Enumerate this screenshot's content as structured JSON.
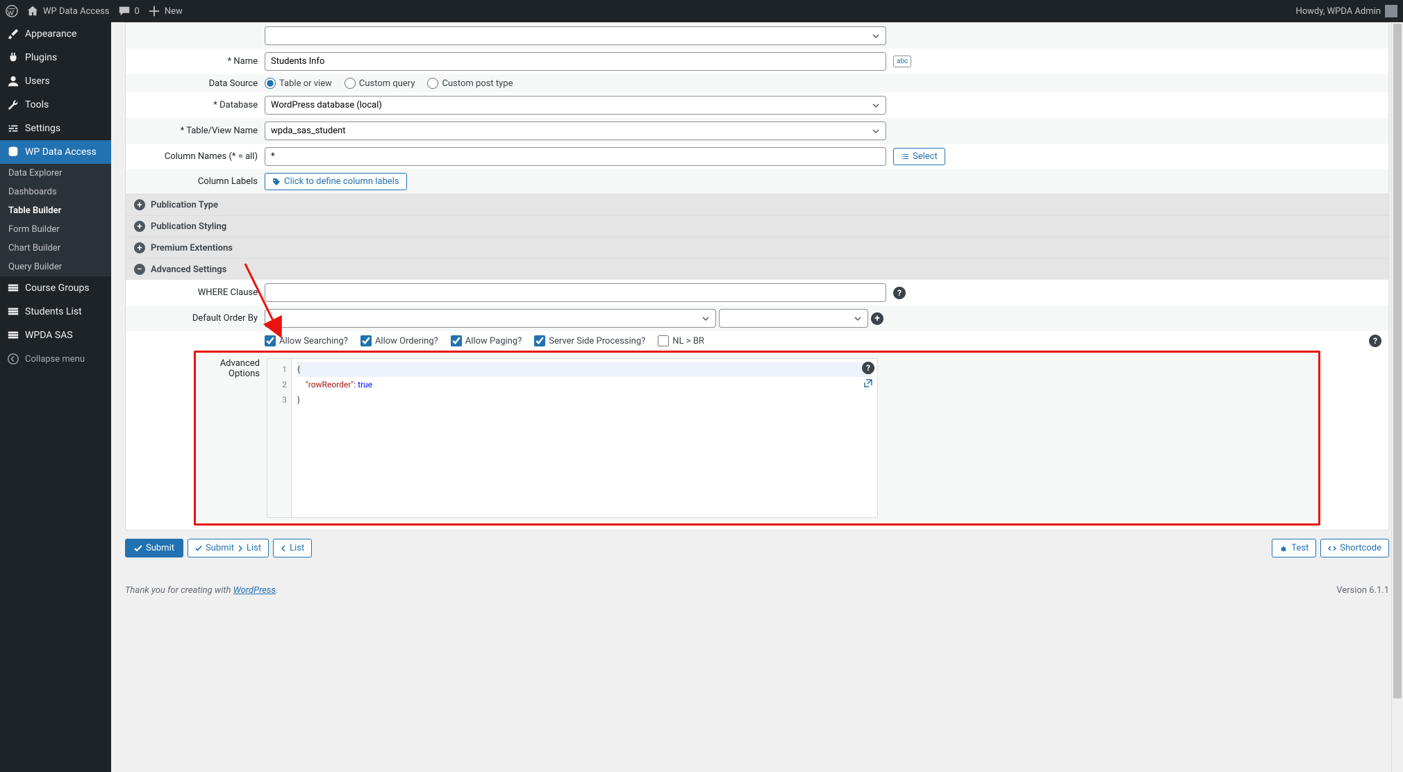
{
  "adminBar": {
    "siteName": "WP Data Access",
    "commentsCount": "0",
    "newLabel": "New",
    "howdy": "Howdy, WPDA Admin"
  },
  "sidebar": {
    "items": [
      {
        "label": "Appearance",
        "icon": "brush"
      },
      {
        "label": "Plugins",
        "icon": "plug"
      },
      {
        "label": "Users",
        "icon": "user"
      },
      {
        "label": "Tools",
        "icon": "wrench"
      },
      {
        "label": "Settings",
        "icon": "sliders"
      },
      {
        "label": "WP Data Access",
        "icon": "database",
        "active": true
      },
      {
        "label": "Course Groups",
        "icon": "layers"
      },
      {
        "label": "Students List",
        "icon": "layers"
      },
      {
        "label": "WPDA SAS",
        "icon": "layers"
      }
    ],
    "subItems": [
      {
        "label": "Data Explorer"
      },
      {
        "label": "Dashboards"
      },
      {
        "label": "Table Builder",
        "current": true
      },
      {
        "label": "Form Builder"
      },
      {
        "label": "Chart Builder"
      },
      {
        "label": "Query Builder"
      }
    ],
    "collapseLabel": "Collapse menu"
  },
  "form": {
    "nameLabel": "* Name",
    "nameValue": "Students Info",
    "dataSourceLabel": "Data Source",
    "dataSourceOptions": [
      "Table or view",
      "Custom query",
      "Custom post type"
    ],
    "databaseLabel": "* Database",
    "databaseValue": "WordPress database (local)",
    "tableLabel": "* Table/View Name",
    "tableValue": "wpda_sas_student",
    "columnNamesLabel": "Column Names (* = all)",
    "columnNamesValue": "*",
    "selectBtn": "Select",
    "columnLabelsLabel": "Column Labels",
    "columnLabelsBtn": "Click to define column labels"
  },
  "sections": {
    "publicationType": "Publication Type",
    "publicationStyling": "Publication Styling",
    "premiumExtensions": "Premium Extentions",
    "advancedSettings": "Advanced Settings"
  },
  "advanced": {
    "whereLabel": "WHERE Clause",
    "whereValue": "",
    "orderLabel": "Default Order By",
    "checkboxes": {
      "allowSearching": "Allow Searching?",
      "allowOrdering": "Allow Ordering?",
      "allowPaging": "Allow Paging?",
      "serverSide": "Server Side Processing?",
      "nlbr": "NL > BR"
    },
    "advancedOptionsLabel": "Advanced Options",
    "code": {
      "line1": "{",
      "line2key": "\"rowReorder\"",
      "line2sep": ": ",
      "line2val": "true",
      "line3": "}"
    }
  },
  "footer": {
    "submit": "Submit",
    "submitList": "Submit",
    "listWord": "List",
    "list": "List",
    "test": "Test",
    "shortcode": "Shortcode",
    "thankYou": "Thank you for creating with ",
    "wpLink": "WordPress",
    "period": ".",
    "version": "Version 6.1.1"
  }
}
